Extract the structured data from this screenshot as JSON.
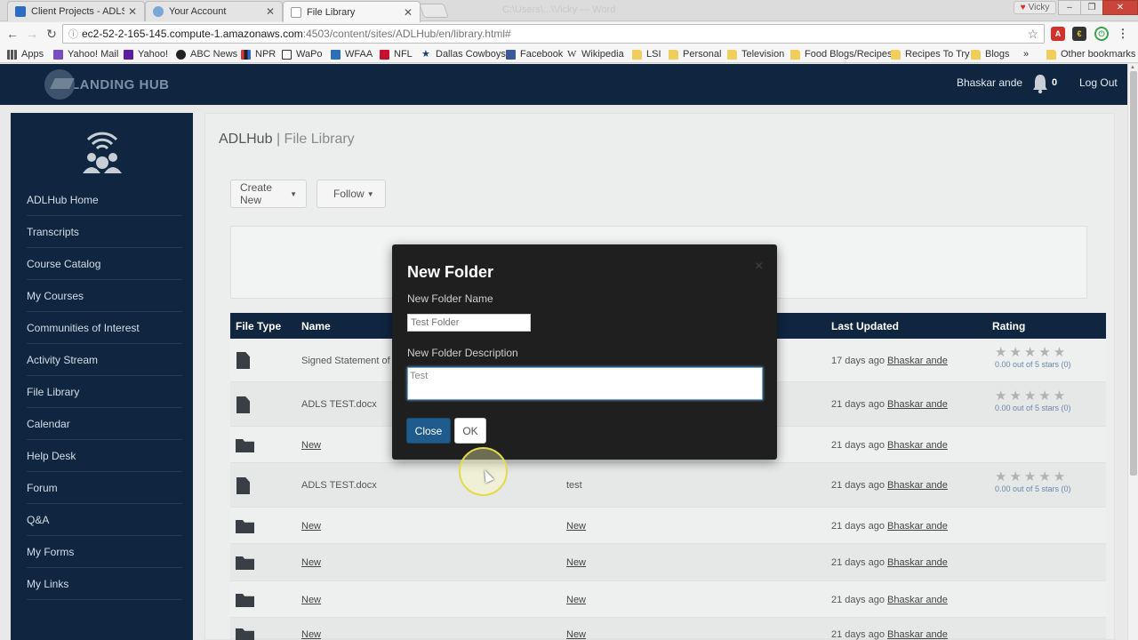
{
  "browser": {
    "tabs": [
      {
        "title": "Client Projects - ADLS U",
        "favicon_color": "#2b6cc4"
      },
      {
        "title": "Your Account",
        "favicon_color": "#7aa7d6"
      },
      {
        "title": "File Library",
        "favicon_color": "#ffffff"
      }
    ],
    "ghost_tab_title": "C:\\Users\\...\\Vicky — Word",
    "profile_name": "Vicky",
    "url_host": "ec2-52-2-165-145.compute-1.amazonaws.com",
    "url_path": ":4503/content/sites/ADLHub/en/library.html#",
    "bookmarks": [
      {
        "label": "Apps",
        "icon": "apps-grid-icon"
      },
      {
        "label": "Yahoo! Mail",
        "icon": "mail-icon"
      },
      {
        "label": "Yahoo!",
        "icon": "yahoo-icon"
      },
      {
        "label": "ABC News",
        "icon": "abc-icon"
      },
      {
        "label": "NPR",
        "icon": "npr-icon"
      },
      {
        "label": "WaPo",
        "icon": "wapo-icon"
      },
      {
        "label": "WFAA",
        "icon": "wfaa-icon"
      },
      {
        "label": "NFL",
        "icon": "nfl-icon"
      },
      {
        "label": "Dallas Cowboys",
        "icon": "star-icon"
      },
      {
        "label": "Facebook",
        "icon": "facebook-icon"
      },
      {
        "label": "Wikipedia",
        "icon": "wikipedia-icon"
      },
      {
        "label": "LSI",
        "icon": "folder-icon"
      },
      {
        "label": "Personal",
        "icon": "folder-icon"
      },
      {
        "label": "Television",
        "icon": "folder-icon"
      },
      {
        "label": "Food Blogs/Recipes",
        "icon": "folder-icon"
      },
      {
        "label": "Recipes To Try",
        "icon": "folder-icon"
      },
      {
        "label": "Blogs",
        "icon": "folder-icon"
      },
      {
        "label": "»",
        "icon": ""
      },
      {
        "label": "Other bookmarks",
        "icon": "folder-icon"
      }
    ]
  },
  "header": {
    "logo_text": "LANDING HUB",
    "user_name": "Bhaskar ande",
    "notification_count": "0",
    "logout_label": "Log Out"
  },
  "sidebar": {
    "items": [
      "ADLHub Home",
      "Transcripts",
      "Course Catalog",
      "My Courses",
      "Communities of Interest",
      "Activity Stream",
      "File Library",
      "Calendar",
      "Help Desk",
      "Forum",
      "Q&A",
      "My Forms",
      "My Links"
    ]
  },
  "main": {
    "title_site": "ADLHub",
    "title_sep": "|",
    "title_page": "File Library",
    "create_new_label": "Create New",
    "follow_label": "Follow"
  },
  "table": {
    "headers": {
      "file_type": "File Type",
      "name": "Name",
      "last_updated": "Last Updated",
      "rating": "Rating"
    },
    "rows": [
      {
        "type": "file",
        "name": "Signed Statement of",
        "desc": "",
        "link": false,
        "updated": "17 days ago",
        "user": "Bhaskar ande",
        "stars": "★★★★★",
        "rating": "0.00 out of 5 stars (0)"
      },
      {
        "type": "file",
        "name": "ADLS TEST.docx",
        "desc": "",
        "link": false,
        "updated": "21 days ago",
        "user": "Bhaskar ande",
        "stars": "★★★★★",
        "rating": "0.00 out of 5 stars (0)"
      },
      {
        "type": "folder",
        "name": "New",
        "desc": "",
        "link": true,
        "updated": "21 days ago",
        "user": "Bhaskar ande",
        "stars": "",
        "rating": ""
      },
      {
        "type": "file",
        "name": "ADLS TEST.docx",
        "desc": "test",
        "link": false,
        "updated": "21 days ago",
        "user": "Bhaskar ande",
        "stars": "★★★★★",
        "rating": "0.00 out of 5 stars (0)"
      },
      {
        "type": "folder",
        "name": "New",
        "desc": "New",
        "link": true,
        "updated": "21 days ago",
        "user": "Bhaskar ande",
        "stars": "",
        "rating": ""
      },
      {
        "type": "folder",
        "name": "New",
        "desc": "New",
        "link": true,
        "updated": "21 days ago",
        "user": "Bhaskar ande",
        "stars": "",
        "rating": ""
      },
      {
        "type": "folder",
        "name": "New",
        "desc": "New",
        "link": true,
        "updated": "21 days ago",
        "user": "Bhaskar ande",
        "stars": "",
        "rating": ""
      },
      {
        "type": "folder",
        "name": "New",
        "desc": "New",
        "link": true,
        "updated": "21 days ago",
        "user": "Bhaskar ande",
        "stars": "",
        "rating": ""
      }
    ]
  },
  "modal": {
    "title": "New Folder",
    "close_x": "×",
    "name_label": "New Folder Name",
    "name_value": "Test Folder",
    "desc_label": "New Folder Description",
    "desc_value": "Test",
    "close_label": "Close",
    "ok_label": "OK"
  },
  "colors": {
    "navy": "#0f2540",
    "primary_button": "#1f5b8c",
    "modal_bg": "#1f1f1f"
  }
}
